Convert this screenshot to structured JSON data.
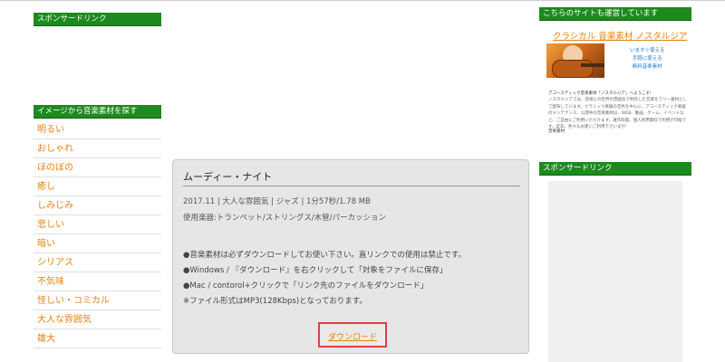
{
  "left_sidebar": {
    "sponsor_heading": "スポンサードリンク",
    "image_heading": "イメージから音楽素材を探す",
    "categories": [
      "明るい",
      "おしゃれ",
      "ほのぼの",
      "癒し",
      "しみじみ",
      "悲しい",
      "暗い",
      "シリアス",
      "不気味",
      "怪しい・コミカル",
      "大人な雰囲気",
      "雄大"
    ]
  },
  "track": {
    "title": "ムーディー・ナイト",
    "meta": "2017.11 | 大人な雰囲気 | ジャズ | 1分57秒/1.78 MB",
    "instruments": "使用楽器:トランペット/ストリングス/木管/パーカッション",
    "notes": [
      "●音楽素材は必ずダウンロードしてお使い下さい。直リンクでの使用は禁止です。",
      "●Windows / 『ダウンロード』を右クリックして「対象をファイルに保存」",
      "●Mac / contorol+クリックで「リンク先のファイルをダウンロード」",
      "※ファイル形式はMP3(128Kbps)となっております。"
    ],
    "download_label": "ダウンロード"
  },
  "right_column": {
    "notice_heading": "こちらのサイトも運営しています",
    "ad_title": "クラシカル 音楽素材 ノスタルジア",
    "ad_tagline": [
      "いますぐ使える",
      "手軽に使える",
      "無料音楽素材"
    ],
    "ad_small_heading": "アコースティック音楽素材「ノスタルジア」へようこそ!",
    "ad_small_text": "ノスタルジアでは、皆様との世界の雰囲気で制作した音楽をフリー素材として配布しています。クラシック楽器の音色を中心に、アコースティック楽器のメンテナンス、公開中の音楽素材は、WEB、動画、ゲーム、イベントなど、ご自由にご利用いただけます。著作料無、個人利用無料で利用が可能です。是非、色々なお使いご利用下さいませ!",
    "ad_small_foot": "音楽素材",
    "sponsor_heading": "スポンサードリンク"
  }
}
